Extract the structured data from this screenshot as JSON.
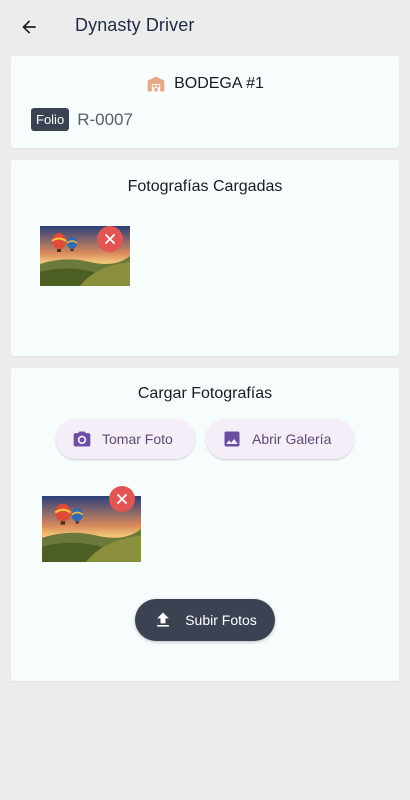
{
  "appbar": {
    "title": "Dynasty Driver",
    "back_icon": "arrow-back-icon"
  },
  "warehouse": {
    "icon": "warehouse-icon",
    "name": "BODEGA #1",
    "folio_label": "Folio",
    "folio_value": "R-0007"
  },
  "uploaded_section": {
    "title": "Fotografías Cargadas",
    "photos": [
      {
        "thumbnail": "hot-air-balloons-landscape",
        "remove_icon": "close-icon"
      }
    ]
  },
  "upload_section": {
    "title": "Cargar Fotografías",
    "take_photo_label": "Tomar Foto",
    "take_photo_icon": "camera-icon",
    "gallery_label": "Abrir Galería",
    "gallery_icon": "image-icon",
    "pending_photos": [
      {
        "thumbnail": "hot-air-balloons-landscape",
        "remove_icon": "close-icon"
      }
    ],
    "upload_label": "Subir Fotos",
    "upload_icon": "upload-icon"
  },
  "colors": {
    "background": "#ececec",
    "card": "#f7fdfc",
    "primary_dark": "#3b4353",
    "accent_purple": "#6b4fa0",
    "remove_red": "#e25555",
    "warehouse_icon": "#e8a98a"
  }
}
